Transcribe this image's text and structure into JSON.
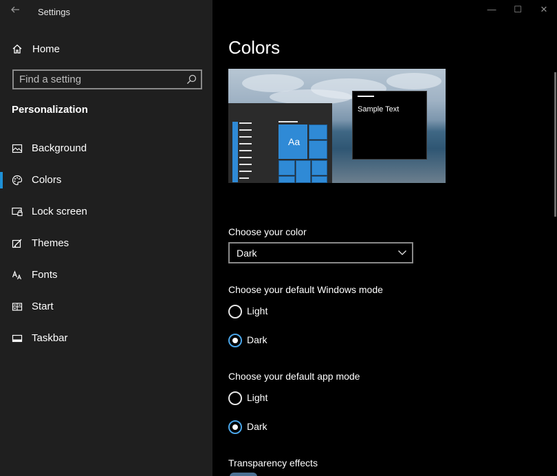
{
  "window": {
    "title": "Settings",
    "controls": {
      "minimize": "—",
      "maximize": "☐",
      "close": "✕"
    }
  },
  "sidebar": {
    "home_label": "Home",
    "search_placeholder": "Find a setting",
    "section_title": "Personalization",
    "items": [
      {
        "label": "Background",
        "icon": "picture-icon",
        "selected": false
      },
      {
        "label": "Colors",
        "icon": "palette-icon",
        "selected": true
      },
      {
        "label": "Lock screen",
        "icon": "lock-screen-icon",
        "selected": false
      },
      {
        "label": "Themes",
        "icon": "brush-icon",
        "selected": false
      },
      {
        "label": "Fonts",
        "icon": "font-icon",
        "selected": false
      },
      {
        "label": "Start",
        "icon": "start-icon",
        "selected": false
      },
      {
        "label": "Taskbar",
        "icon": "taskbar-icon",
        "selected": false
      }
    ],
    "accent_color": "#1e90d6"
  },
  "main": {
    "title": "Colors",
    "preview": {
      "tile_label": "Aa",
      "sample_text": "Sample Text",
      "accent_color": "#2f8ad6"
    },
    "choose_color": {
      "label": "Choose your color",
      "value": "Dark"
    },
    "windows_mode": {
      "label": "Choose your default Windows mode",
      "options": [
        {
          "label": "Light",
          "checked": false
        },
        {
          "label": "Dark",
          "checked": true
        }
      ]
    },
    "app_mode": {
      "label": "Choose your default app mode",
      "options": [
        {
          "label": "Light",
          "checked": false
        },
        {
          "label": "Dark",
          "checked": true
        }
      ]
    },
    "transparency": {
      "label": "Transparency effects"
    }
  }
}
